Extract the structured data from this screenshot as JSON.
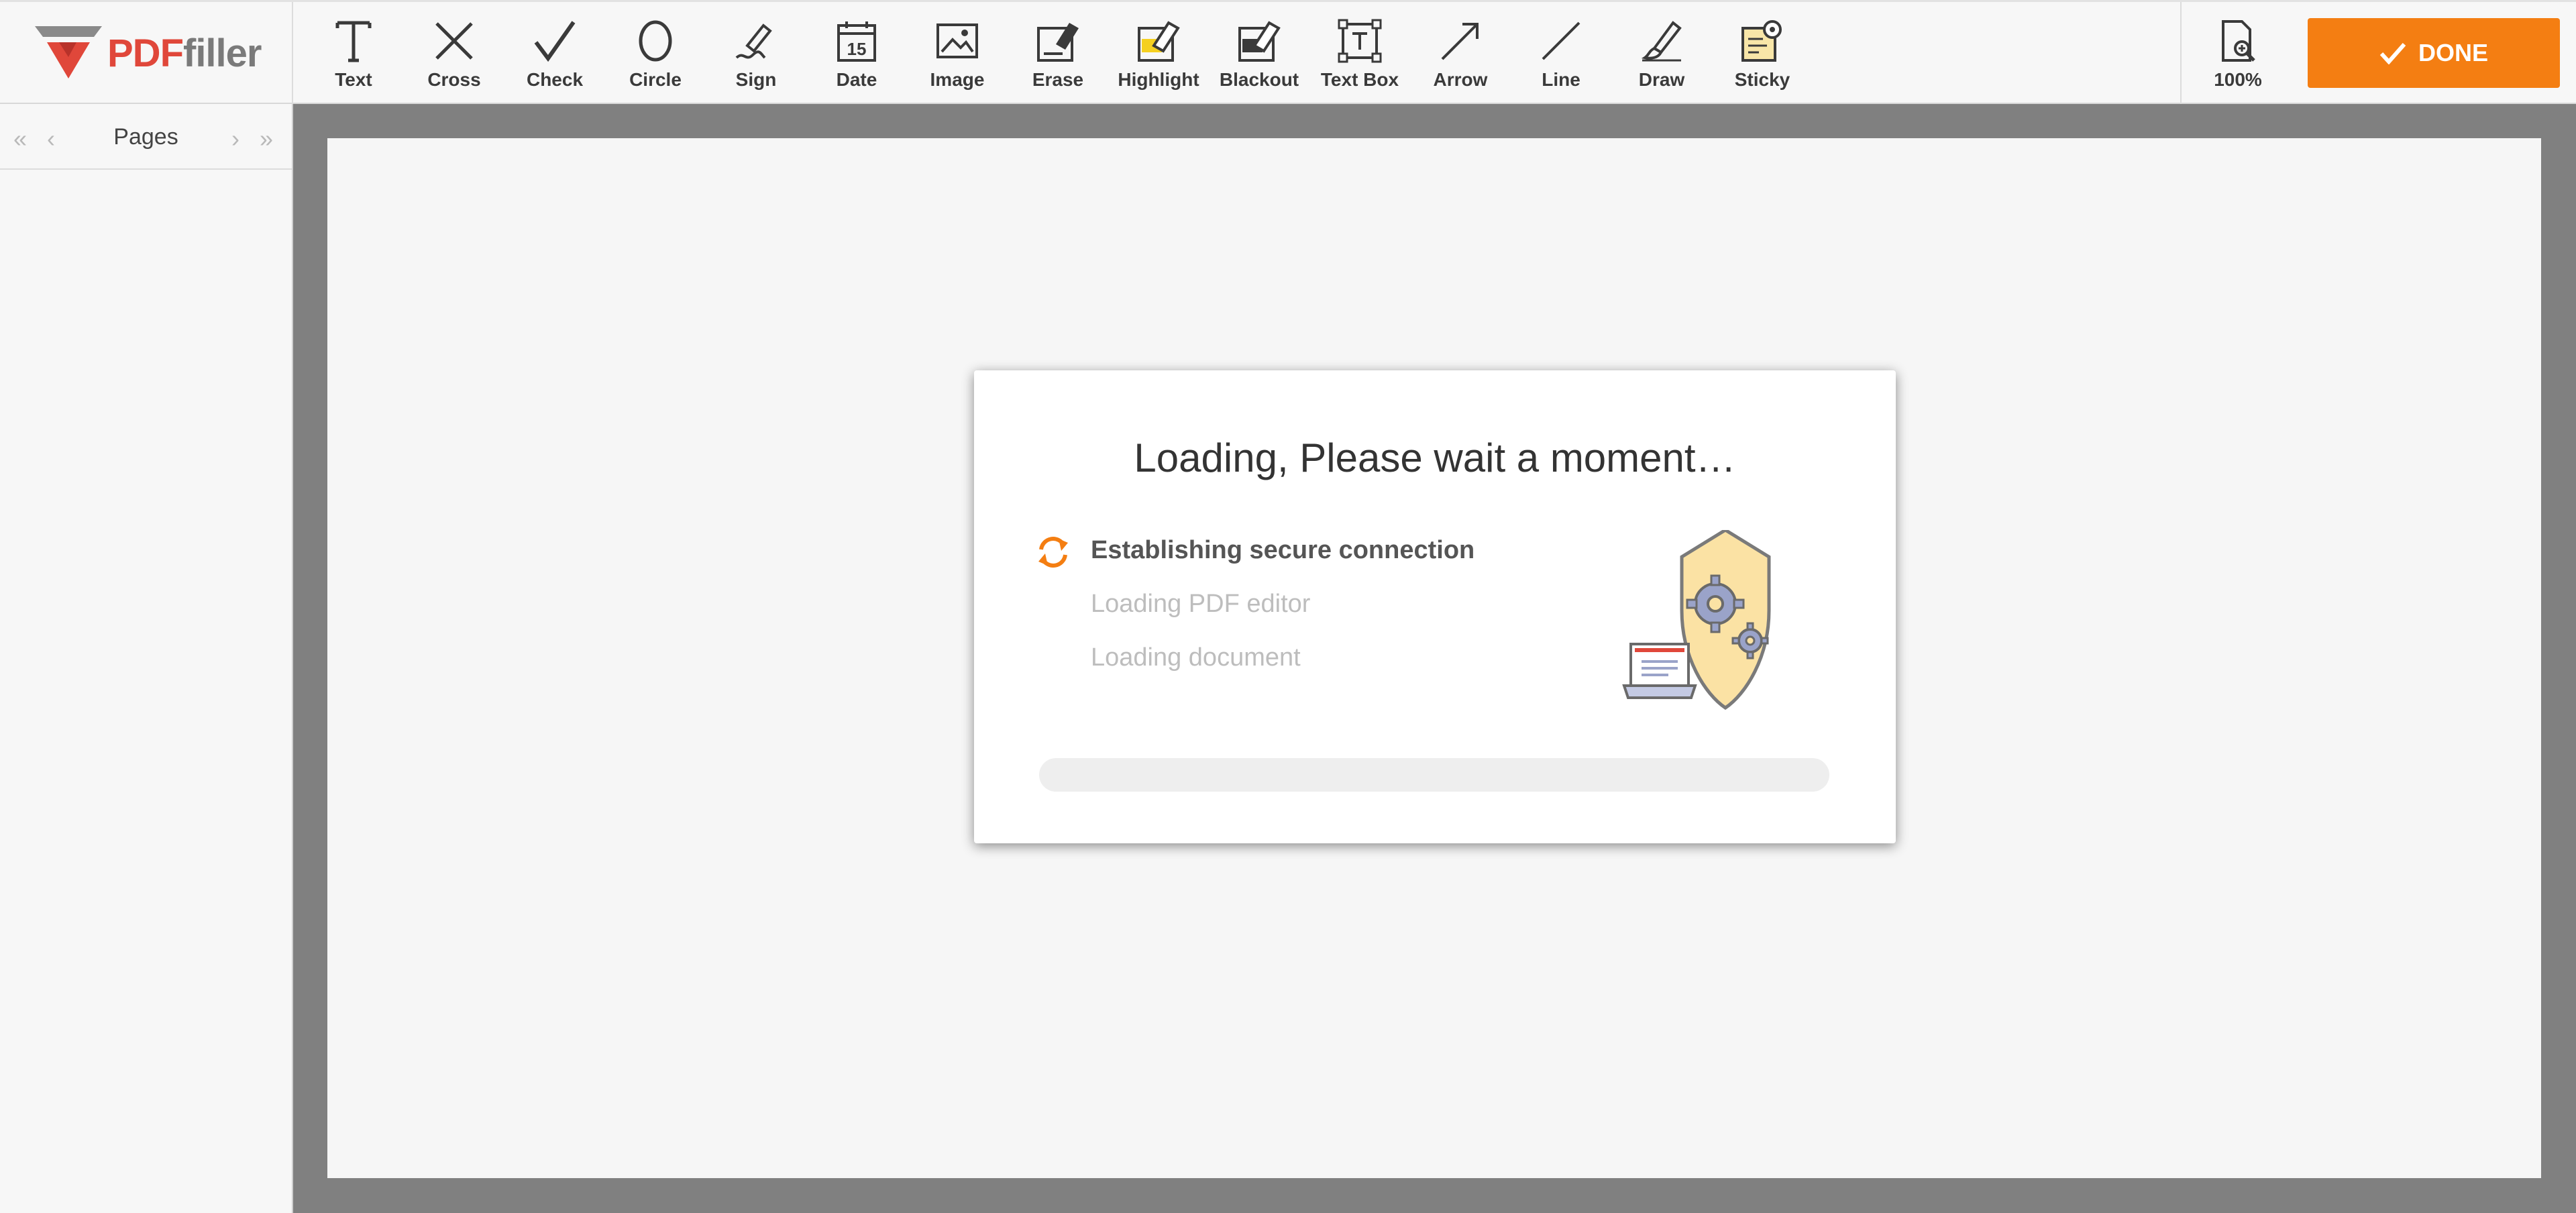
{
  "brand": {
    "pdf": "PDF",
    "filler": "filler"
  },
  "toolbar": {
    "tools": [
      {
        "label": "Text",
        "icon": "text-icon"
      },
      {
        "label": "Cross",
        "icon": "cross-icon"
      },
      {
        "label": "Check",
        "icon": "check-icon"
      },
      {
        "label": "Circle",
        "icon": "circle-icon"
      },
      {
        "label": "Sign",
        "icon": "sign-pen-icon"
      },
      {
        "label": "Date",
        "icon": "calendar-icon",
        "calendar_day": "15"
      },
      {
        "label": "Image",
        "icon": "image-icon"
      },
      {
        "label": "Erase",
        "icon": "eraser-icon"
      },
      {
        "label": "Highlight",
        "icon": "highlighter-icon"
      },
      {
        "label": "Blackout",
        "icon": "blackout-icon"
      },
      {
        "label": "Text Box",
        "icon": "text-box-icon"
      },
      {
        "label": "Arrow",
        "icon": "arrow-icon"
      },
      {
        "label": "Line",
        "icon": "line-icon"
      },
      {
        "label": "Draw",
        "icon": "draw-brush-icon"
      },
      {
        "label": "Sticky",
        "icon": "sticky-note-icon"
      }
    ],
    "zoom_label": "100%",
    "done_label": "DONE",
    "accent_color": "#f47e12"
  },
  "sidebar": {
    "title": "Pages"
  },
  "dialog": {
    "title": "Loading, Please wait a moment…",
    "steps": [
      {
        "label": "Establishing secure connection",
        "state": "active"
      },
      {
        "label": "Loading PDF editor",
        "state": "pending"
      },
      {
        "label": "Loading document",
        "state": "pending"
      }
    ],
    "progress": 0
  }
}
